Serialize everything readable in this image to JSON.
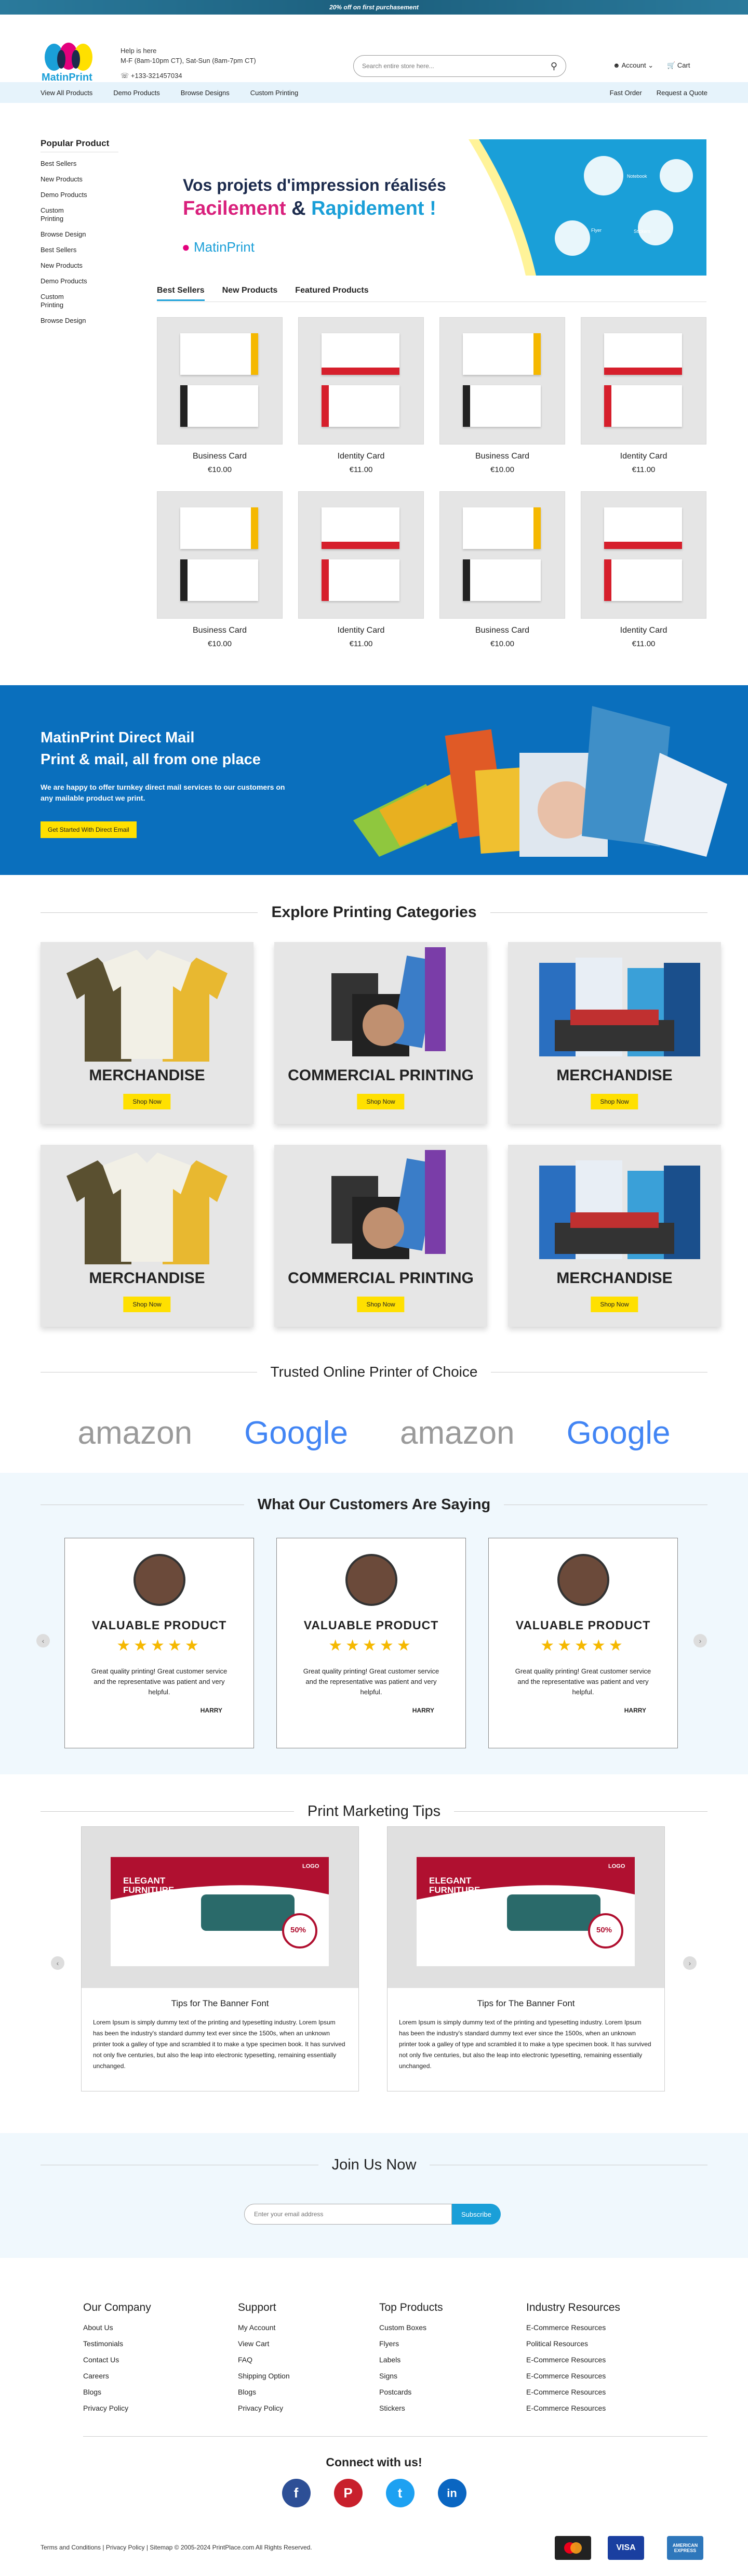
{
  "promo": "20% off on first purchasement",
  "header": {
    "logo": "MatinPrint",
    "help_label": "Help is here",
    "help_hours": "M-F (8am-10pm CT), Sat-Sun (8am-7pm CT)",
    "phone": "+133-321457034",
    "search_placeholder": "Search entire store here...",
    "account": "Account",
    "cart": "Cart"
  },
  "nav": {
    "left": [
      "View All Products",
      "Demo Products",
      "Browse Designs",
      "Custom Printing"
    ],
    "right": [
      "Fast Order",
      "Request a Quote"
    ]
  },
  "sidebar": {
    "title": "Popular Product",
    "items": [
      "Best Sellers",
      "New Products",
      "Demo Products",
      "Custom Printing",
      "Browse Design",
      "Best Sellers",
      "New Products",
      "Demo Products",
      "Custom Printing",
      "Browse Design"
    ]
  },
  "banner": {
    "line1": "Vos projets d'impression réalisés",
    "word1": "Facilement",
    "amp": " & ",
    "word2": "Rapidement !",
    "logo": "MatinPrint",
    "icons": [
      "Notebook",
      "Flyer",
      "Stickers"
    ]
  },
  "tabs": [
    "Best Sellers",
    "New Products",
    "Featured Products"
  ],
  "products": [
    {
      "name": "Business Card",
      "price": "€10.00"
    },
    {
      "name": "Identity Card",
      "price": "€11.00"
    },
    {
      "name": "Business Card",
      "price": "€10.00"
    },
    {
      "name": "Identity Card",
      "price": "€11.00"
    },
    {
      "name": "Business Card",
      "price": "€10.00"
    },
    {
      "name": "Identity Card",
      "price": "€11.00"
    },
    {
      "name": "Business Card",
      "price": "€10.00"
    },
    {
      "name": "Identity Card",
      "price": "€11.00"
    }
  ],
  "direct_mail": {
    "title1": "MatinPrint Direct Mail",
    "title2": "Print & mail, all from one place",
    "desc": "We are happy to offer turnkey direct mail services to our customers on any mailable product we print.",
    "button": "Get Started With Direct Email"
  },
  "categories": {
    "title": "Explore Printing Categories",
    "items": [
      "MERCHANDISE",
      "COMMERCIAL PRINTING",
      "MERCHANDISE",
      "MERCHANDISE",
      "COMMERCIAL PRINTING",
      "MERCHANDISE"
    ],
    "button": "Shop Now"
  },
  "partners": {
    "title": "Trusted Online Printer of Choice",
    "logos": [
      "amazon",
      "Google",
      "amazon",
      "Google"
    ]
  },
  "reviews": {
    "title": "What Our Customers Are Saying",
    "items": [
      {
        "heading": "VALUABLE PRODUCT",
        "stars": "★★★★★",
        "text": "Great quality printing! Great customer service and the representative was patient and very helpful.",
        "author": "HARRY"
      },
      {
        "heading": "VALUABLE PRODUCT",
        "stars": "★★★★★",
        "text": "Great quality printing! Great customer service and the representative was patient and very helpful.",
        "author": "HARRY"
      },
      {
        "heading": "VALUABLE PRODUCT",
        "stars": "★★★★★",
        "text": "Great quality printing! Great customer service and the representative was patient and very helpful.",
        "author": "HARRY"
      }
    ]
  },
  "tips": {
    "title": "Print Marketing Tips",
    "items": [
      {
        "heading": "Tips for The Banner Font",
        "text": "Lorem Ipsum is simply dummy text of the printing and typesetting industry. Lorem Ipsum has been the industry's standard dummy text ever since the 1500s, when an unknown printer took a galley of type and scrambled it to make a type specimen book. It has survived not only five centuries, but also the leap into electronic typesetting, remaining essentially unchanged.",
        "ad_title": "ELEGANT FURNITURE",
        "ad_discount": "50%",
        "ad_logo": "LOGO"
      },
      {
        "heading": "Tips for The Banner Font",
        "text": "Lorem Ipsum is simply dummy text of the printing and typesetting industry. Lorem Ipsum has been the industry's standard dummy text ever since the 1500s, when an unknown printer took a galley of type and scrambled it to make a type specimen book. It has survived not only five centuries, but also the leap into electronic typesetting, remaining essentially unchanged.",
        "ad_title": "ELEGANT FURNITURE",
        "ad_discount": "50%",
        "ad_logo": "LOGO"
      }
    ]
  },
  "join": {
    "title": "Join Us Now",
    "placeholder": "Enter your email address",
    "button": "Subscribe"
  },
  "footer": {
    "cols": [
      {
        "title": "Our Company",
        "links": [
          "About Us",
          "Testimonials",
          "Contact Us",
          "Careers",
          "Blogs",
          "Privacy Policy"
        ]
      },
      {
        "title": "Support",
        "links": [
          "My Account",
          "View Cart",
          "FAQ",
          "Shipping Option",
          "Blogs",
          "Privacy Policy"
        ]
      },
      {
        "title": "Top Products",
        "links": [
          "Custom Boxes",
          "Flyers",
          "Labels",
          "Signs",
          "Postcards",
          "Stickers"
        ]
      },
      {
        "title": "Industry Resources",
        "links": [
          "E-Commerce Resources",
          "Political Resources",
          "E-Commerce Resources",
          "E-Commerce Resources",
          "E-Commerce Resources",
          "E-Commerce Resources"
        ]
      }
    ],
    "connect": "Connect with us!",
    "social": [
      "f",
      "P",
      "t",
      "in"
    ],
    "copyright": "Terms and Conditions | Privacy Policy | Sitemap © 2005-2024 PrintPlace.com All Rights Reserved.",
    "payments": [
      "mastercard",
      "VISA",
      "AMERICAN EXPRESS"
    ]
  },
  "colors": {
    "accent": "#1a9fd8",
    "yellow": "#ffe000",
    "promo": "#1c5f7d",
    "direct_mail_bg": "#0a6fbd",
    "light_bg": "#f0f8fd"
  }
}
